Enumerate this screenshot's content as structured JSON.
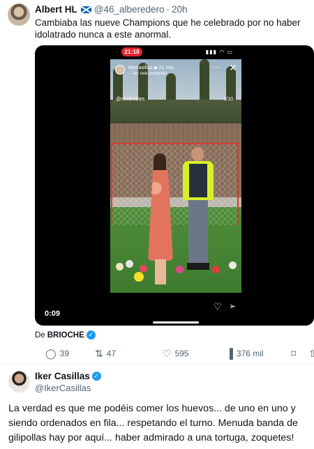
{
  "tweet1": {
    "author_name": "Albert HL",
    "author_handle": "@46_alberedero",
    "separator": "·",
    "time": "20h",
    "text": "Cambiaba las nueve Champions que he celebrado por no haber idolatrado nunca a este anormal.",
    "video": {
      "duration": "0:09",
      "phone_clock": "21:18",
      "story_user": "ikercasillas ◆ 21 min",
      "story_sub": "♪ Ver reel completo",
      "tag_left": "@nesdrobles",
      "tag_right": "0/10"
    },
    "source_prefix": "De",
    "source_name": "BRIOCHE",
    "stats": {
      "replies": "39",
      "retweets": "47",
      "likes": "595",
      "views": "376 mil"
    },
    "icons": [
      "reply-icon",
      "retweet-icon",
      "like-icon",
      "views-icon",
      "bookmark-icon",
      "share-icon",
      "heart-icon",
      "send-icon",
      "close-icon",
      "verified-badge-icon",
      "scotland-flag-icon"
    ]
  },
  "tweet2": {
    "author_name": "Iker Casillas",
    "author_handle": "@IkerCasillas",
    "text": "La verdad es que me podéis comer los huevos... de uno en uno y siendo ordenados en fila... respetando el turno. Menuda banda de gilipollas hay por aquí...  haber admirado a una tortuga, zoquetes!"
  },
  "colors": {
    "text": "#0f1419",
    "secondary": "#536471",
    "verified": "#1d9bf0",
    "clock_pill": "#e0242c"
  }
}
